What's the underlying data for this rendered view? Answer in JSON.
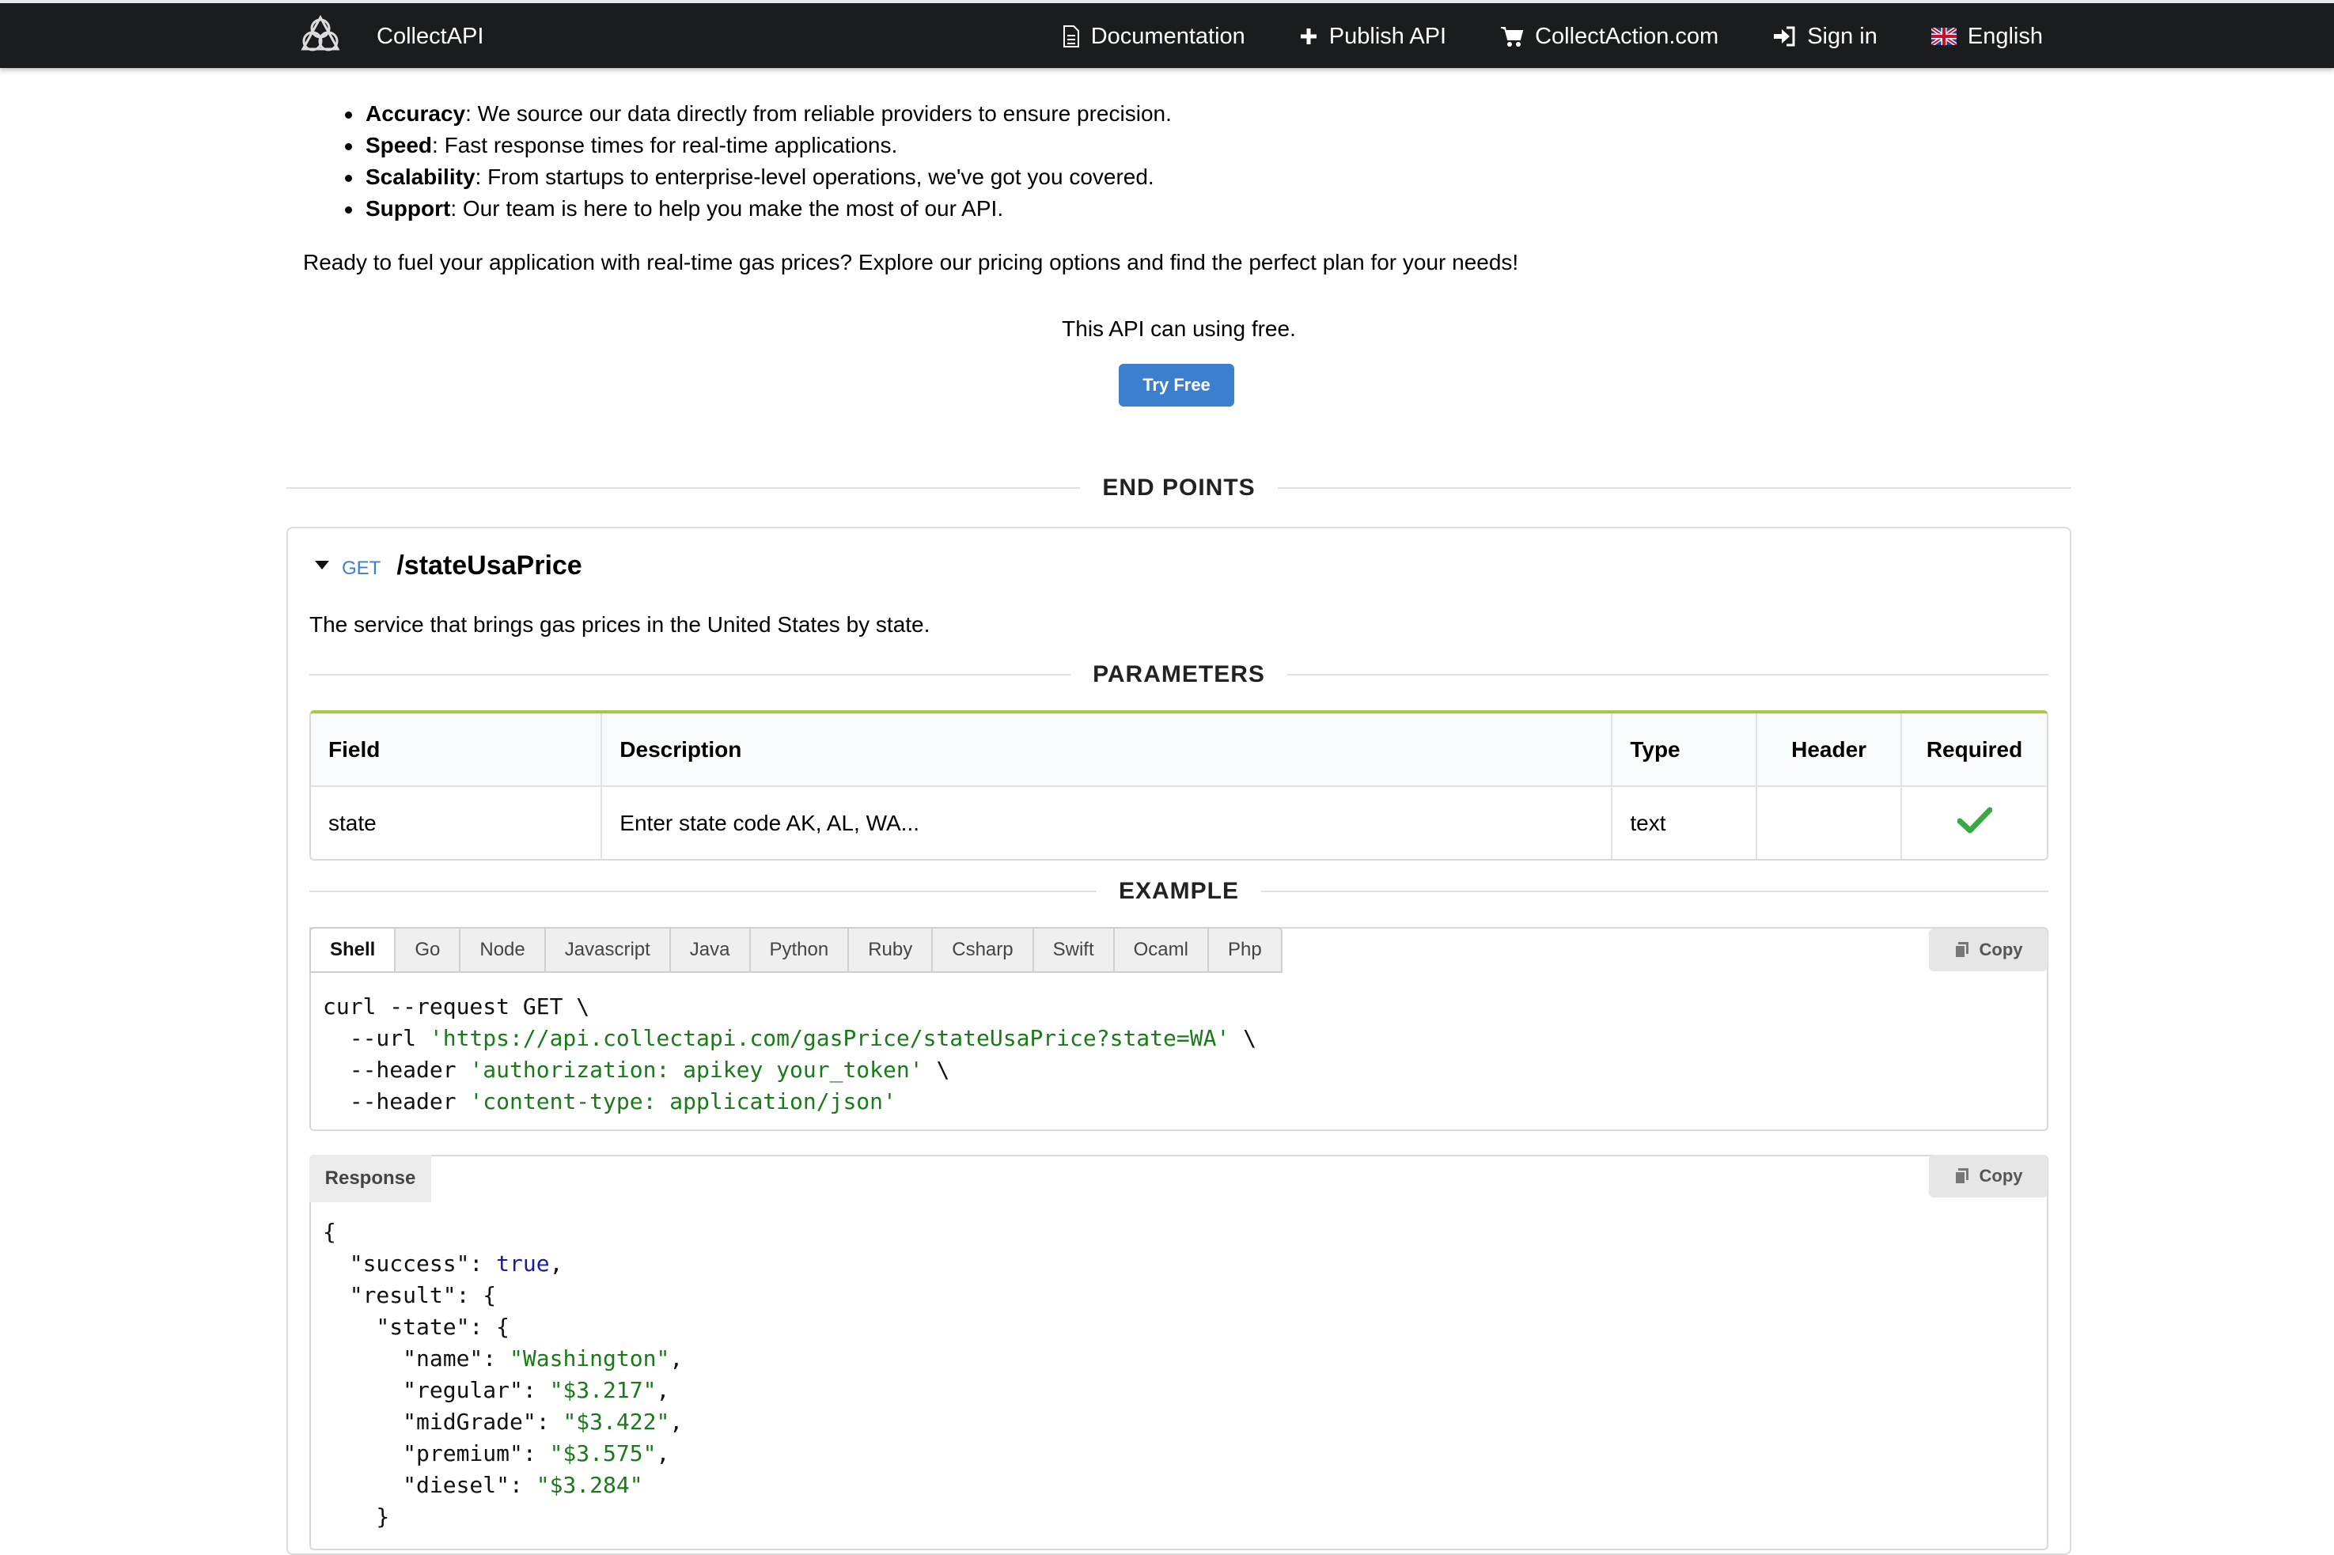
{
  "nav": {
    "brand": "CollectAPI",
    "items": [
      {
        "label": "Documentation",
        "icon": "document-icon"
      },
      {
        "label": "Publish API",
        "icon": "plus-icon"
      },
      {
        "label": "CollectAction.com",
        "icon": "cart-icon"
      },
      {
        "label": "Sign in",
        "icon": "sign-in-icon"
      },
      {
        "label": "English",
        "icon": "uk-flag-icon"
      }
    ]
  },
  "features": [
    {
      "term": "Accuracy",
      "text": ": We source our data directly from reliable providers to ensure precision."
    },
    {
      "term": "Speed",
      "text": ": Fast response times for real-time applications."
    },
    {
      "term": "Scalability",
      "text": ": From startups to enterprise-level operations, we've got you covered."
    },
    {
      "term": "Support",
      "text": ": Our team is here to help you make the most of our API."
    }
  ],
  "ready_text": "Ready to fuel your application with real-time gas prices? Explore our pricing options and find the perfect plan for your needs!",
  "free_note": "This API can using free.",
  "try_free": "Try Free",
  "endpoints_heading": "END POINTS",
  "endpoint": {
    "method": "GET",
    "path": "/stateUsaPrice",
    "description": "The service that brings gas prices in the United States by state."
  },
  "parameters_heading": "PARAMETERS",
  "params_table": {
    "headers": [
      "Field",
      "Description",
      "Type",
      "Header",
      "Required"
    ],
    "rows": [
      {
        "field": "state",
        "description": "Enter state code AK, AL, WA...",
        "type": "text",
        "header": "",
        "required": true
      }
    ]
  },
  "example_heading": "EXAMPLE",
  "code_tabs": [
    "Shell",
    "Go",
    "Node",
    "Javascript",
    "Java",
    "Python",
    "Ruby",
    "Csharp",
    "Swift",
    "Ocaml",
    "Php"
  ],
  "active_tab": "Shell",
  "copy_label": "Copy",
  "request_code": {
    "l1": "curl --request GET \\",
    "l2_a": "  --url ",
    "l2_b": "'https://api.collectapi.com/gasPrice/stateUsaPrice?state=WA'",
    "l2_c": " \\",
    "l3_a": "  --header ",
    "l3_b": "'authorization: apikey your_token'",
    "l3_c": " \\",
    "l4_a": "  --header ",
    "l4_b": "'content-type: application/json'"
  },
  "response_tab": "Response",
  "response_code": {
    "open": "{",
    "success_key": "  \"success\": ",
    "success_val": "true",
    "result_key": "  \"result\": {",
    "state_key": "    \"state\": {",
    "name_key": "      \"name\": ",
    "name_val": "\"Washington\"",
    "regular_key": "      \"regular\": ",
    "regular_val": "\"$3.217\"",
    "mid_key": "      \"midGrade\": ",
    "mid_val": "\"$3.422\"",
    "premium_key": "      \"premium\": ",
    "premium_val": "\"$3.575\"",
    "diesel_key": "      \"diesel\": ",
    "diesel_val": "\"$3.284\"",
    "close_state": "    }"
  },
  "colors": {
    "nav_bg": "#1b1c1d",
    "primary": "#3d7fcf",
    "table_accent": "#a5c848",
    "check": "#3aa845",
    "code_string": "#1a7a1a"
  }
}
